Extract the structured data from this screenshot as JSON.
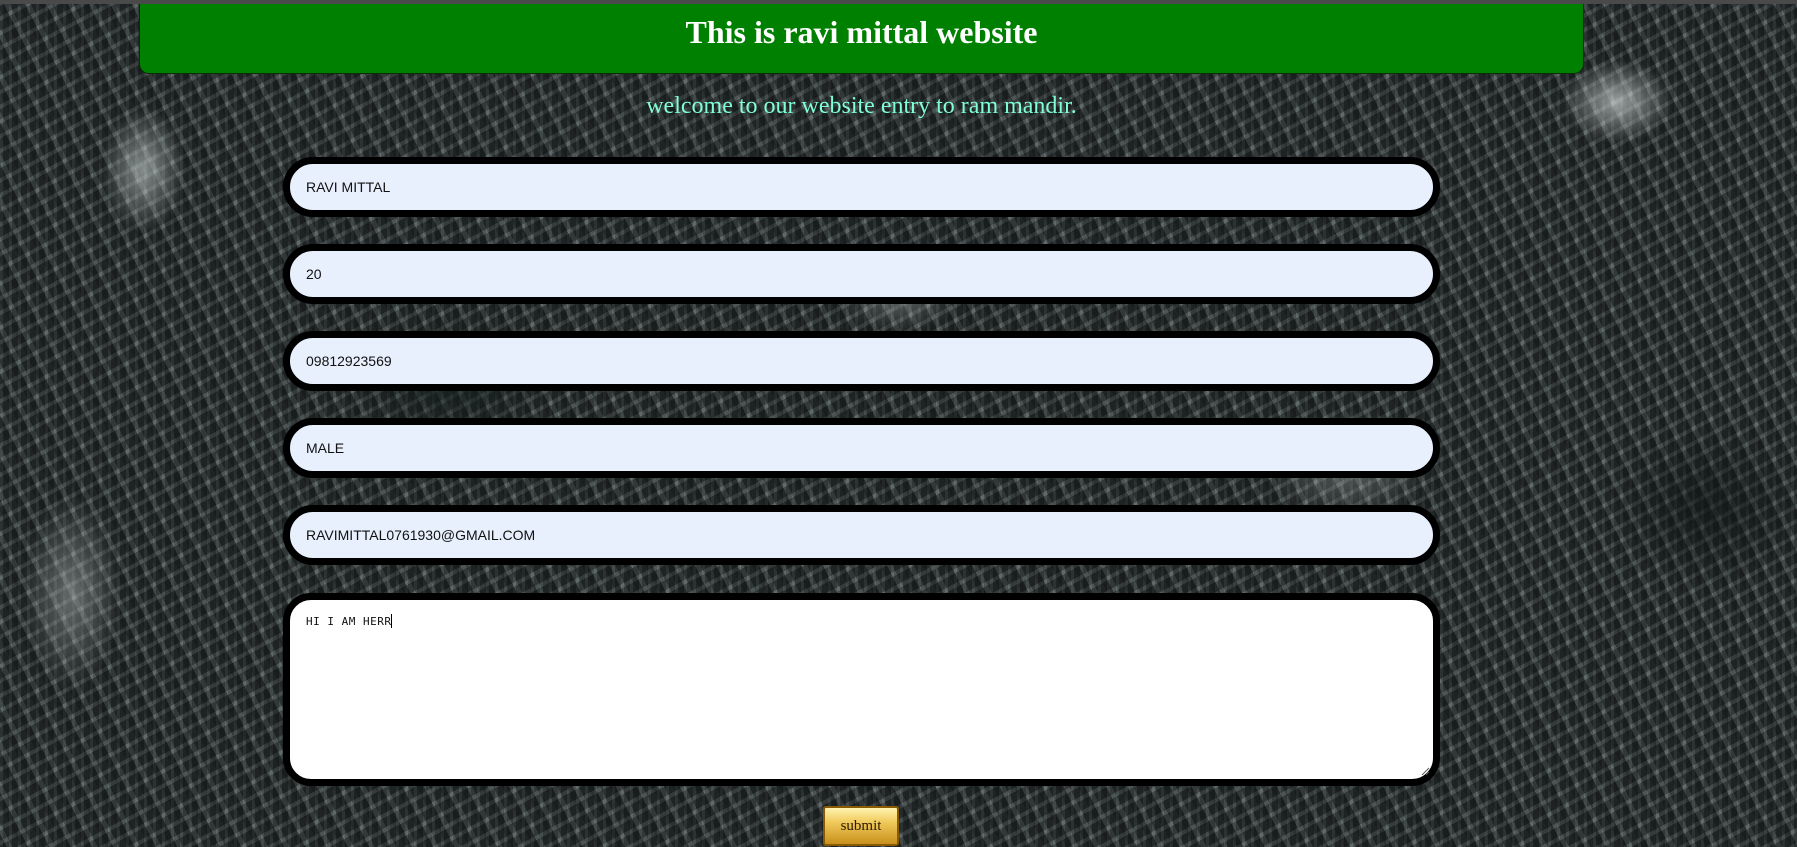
{
  "header": {
    "title": "This is ravi mittal website"
  },
  "welcome_text": "welcome to our website entry to ram mandir.",
  "form": {
    "name_value": "RAVI MITTAL",
    "age_value": "20",
    "phone_value": "09812923569",
    "gender_value": "MALE",
    "email_value": "RAVIMITTAL0761930@GMAIL.COM",
    "message_value": "HI I AM HERR",
    "submit_label": "submit"
  },
  "colors": {
    "header_bg": "#008000",
    "welcome_text": "#7fffd4",
    "field_bg": "#e8f0fe",
    "field_border": "#000000"
  }
}
